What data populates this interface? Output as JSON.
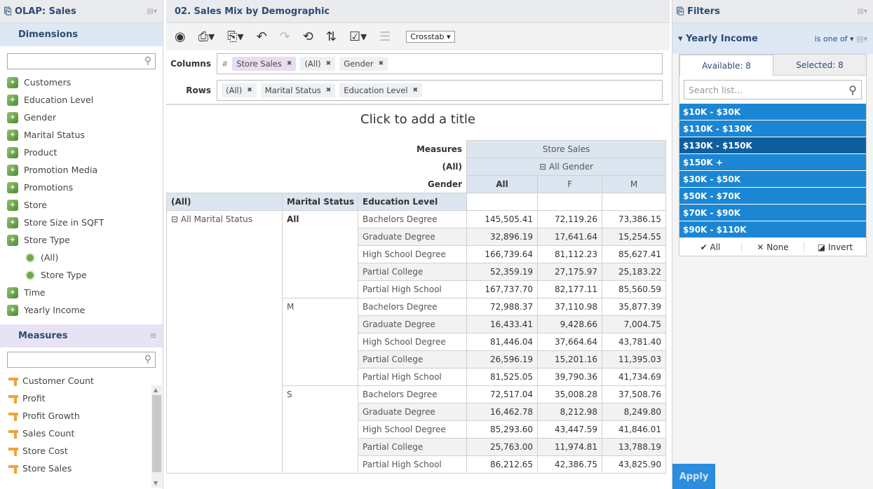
{
  "left": {
    "header": "OLAP: Sales",
    "dimensions_title": "Dimensions",
    "dimensions": [
      {
        "label": "Customers",
        "level": 0
      },
      {
        "label": "Education Level",
        "level": 0
      },
      {
        "label": "Gender",
        "level": 0
      },
      {
        "label": "Marital Status",
        "level": 0
      },
      {
        "label": "Product",
        "level": 0
      },
      {
        "label": "Promotion Media",
        "level": 0
      },
      {
        "label": "Promotions",
        "level": 0
      },
      {
        "label": "Store",
        "level": 0
      },
      {
        "label": "Store Size in SQFT",
        "level": 0
      },
      {
        "label": "Store Type",
        "level": 0
      },
      {
        "label": "(All)",
        "level": 1
      },
      {
        "label": "Store Type",
        "level": 1
      },
      {
        "label": "Time",
        "level": 0
      },
      {
        "label": "Yearly Income",
        "level": 0
      }
    ],
    "measures_title": "Measures",
    "measures": [
      "Customer Count",
      "Profit",
      "Profit Growth",
      "Sales Count",
      "Store Cost",
      "Store Sales"
    ]
  },
  "center": {
    "report_title": "02. Sales Mix by Demographic",
    "view_select": "Crosstab",
    "columns_label": "Columns",
    "rows_label": "Rows",
    "columns": [
      {
        "label": "Store Sales",
        "measure": true
      },
      {
        "label": "(All)",
        "measure": false
      },
      {
        "label": "Gender",
        "measure": false
      }
    ],
    "rows": [
      {
        "label": "(All)"
      },
      {
        "label": "Marital Status"
      },
      {
        "label": "Education Level"
      }
    ],
    "title_placeholder": "Click to add a title",
    "table": {
      "measures_label": "Measures",
      "all_label": "(All)",
      "gender_label": "Gender",
      "store_sales": "Store Sales",
      "all_gender": "All Gender",
      "col_all": "All",
      "col_f": "F",
      "col_m": "M",
      "row_hdr_all": "(All)",
      "row_hdr_marital": "Marital Status",
      "row_hdr_education": "Education Level",
      "all_marital": "All Marital Status",
      "groups": [
        {
          "marital": "All",
          "bold": true,
          "rows": [
            {
              "edu": "Bachelors Degree",
              "all": "145,505.41",
              "f": "72,119.26",
              "m": "73,386.15"
            },
            {
              "edu": "Graduate Degree",
              "all": "32,896.19",
              "f": "17,641.64",
              "m": "15,254.55"
            },
            {
              "edu": "High School Degree",
              "all": "166,739.64",
              "f": "81,112.23",
              "m": "85,627.41"
            },
            {
              "edu": "Partial College",
              "all": "52,359.19",
              "f": "27,175.97",
              "m": "25,183.22"
            },
            {
              "edu": "Partial High School",
              "all": "167,737.70",
              "f": "82,177.11",
              "m": "85,560.59"
            }
          ]
        },
        {
          "marital": "M",
          "bold": false,
          "rows": [
            {
              "edu": "Bachelors Degree",
              "all": "72,988.37",
              "f": "37,110.98",
              "m": "35,877.39"
            },
            {
              "edu": "Graduate Degree",
              "all": "16,433.41",
              "f": "9,428.66",
              "m": "7,004.75"
            },
            {
              "edu": "High School Degree",
              "all": "81,446.04",
              "f": "37,664.64",
              "m": "43,781.40"
            },
            {
              "edu": "Partial College",
              "all": "26,596.19",
              "f": "15,201.16",
              "m": "11,395.03"
            },
            {
              "edu": "Partial High School",
              "all": "81,525.05",
              "f": "39,790.36",
              "m": "41,734.69"
            }
          ]
        },
        {
          "marital": "S",
          "bold": false,
          "rows": [
            {
              "edu": "Bachelors Degree",
              "all": "72,517.04",
              "f": "35,008.28",
              "m": "37,508.76"
            },
            {
              "edu": "Graduate Degree",
              "all": "16,462.78",
              "f": "8,212.98",
              "m": "8,249.80"
            },
            {
              "edu": "High School Degree",
              "all": "85,293.60",
              "f": "43,447.59",
              "m": "41,846.01"
            },
            {
              "edu": "Partial College",
              "all": "25,763.00",
              "f": "11,974.81",
              "m": "13,788.19"
            },
            {
              "edu": "Partial High School",
              "all": "86,212.65",
              "f": "42,386.75",
              "m": "43,825.90"
            }
          ]
        }
      ]
    }
  },
  "right": {
    "header": "Filters",
    "filter_name": "Yearly Income",
    "operator": "is one of",
    "tab_available": "Available: 8",
    "tab_selected": "Selected: 8",
    "search_placeholder": "Search list...",
    "options": [
      {
        "label": "$10K - $30K",
        "highlight": false
      },
      {
        "label": "$110K - $130K",
        "highlight": false
      },
      {
        "label": "$130K - $150K",
        "highlight": true
      },
      {
        "label": "$150K +",
        "highlight": false
      },
      {
        "label": "$30K - $50K",
        "highlight": false
      },
      {
        "label": "$50K - $70K",
        "highlight": false
      },
      {
        "label": "$70K - $90K",
        "highlight": false
      },
      {
        "label": "$90K - $110K",
        "highlight": false
      }
    ],
    "btn_all": "✔ All",
    "btn_none": "✕ None",
    "btn_invert": "Invert",
    "apply": "Apply"
  }
}
